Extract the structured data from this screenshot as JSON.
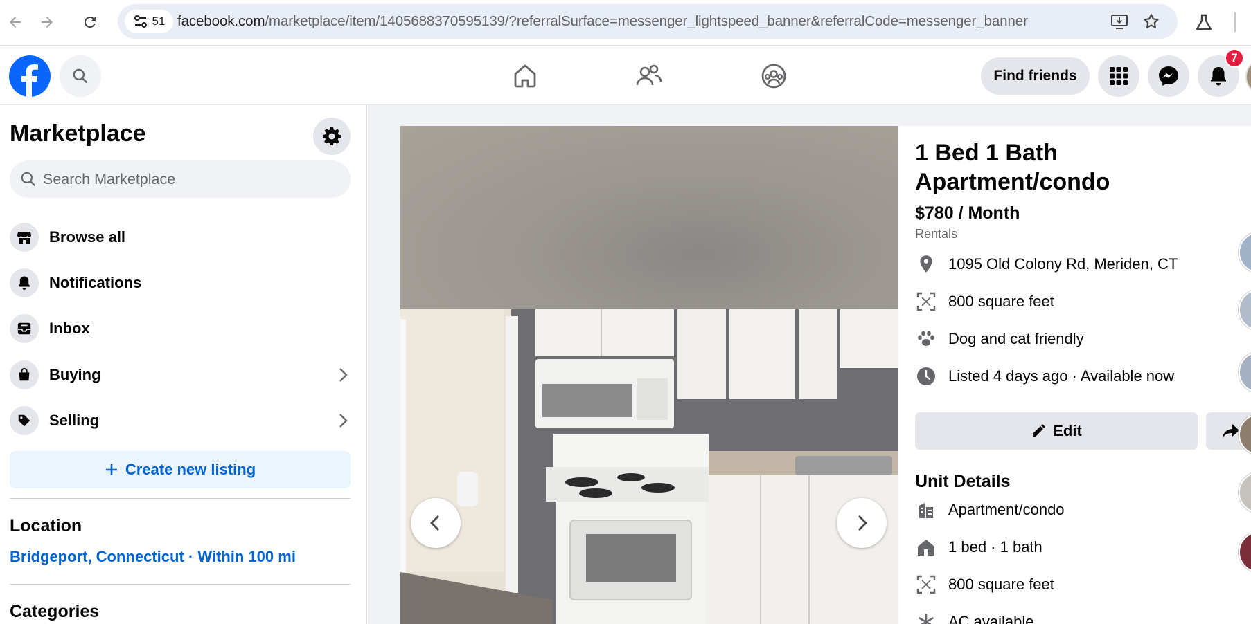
{
  "browser": {
    "tab_count": "51",
    "url_domain": "facebook.com",
    "url_rest": "/marketplace/item/1405688370595139/?referralSurface=messenger_lightspeed_banner&referralCode=messenger_banner"
  },
  "header": {
    "find_friends_label": "Find friends",
    "notification_count": "7"
  },
  "sidebar": {
    "title": "Marketplace",
    "search_placeholder": "Search Marketplace",
    "items": [
      {
        "label": "Browse all",
        "icon": "storefront-icon"
      },
      {
        "label": "Notifications",
        "icon": "bell-icon"
      },
      {
        "label": "Inbox",
        "icon": "inbox-icon"
      },
      {
        "label": "Buying",
        "icon": "shopping-bag-icon"
      },
      {
        "label": "Selling",
        "icon": "price-tag-icon"
      }
    ],
    "create_listing_label": "Create new listing",
    "location_heading": "Location",
    "location_value": "Bridgeport, Connecticut · Within 100 mi",
    "categories_heading": "Categories"
  },
  "listing": {
    "title": "1 Bed 1 Bath Apartment/condo",
    "price": "$780 / Month",
    "category": "Rentals",
    "facts": [
      {
        "icon": "location-pin-icon",
        "text": "1095 Old Colony Rd, Meriden, CT"
      },
      {
        "icon": "area-icon",
        "text": "800 square feet"
      },
      {
        "icon": "paw-icon",
        "text": "Dog and cat friendly"
      },
      {
        "icon": "clock-icon",
        "text": "Listed 4 days ago · Available now"
      }
    ],
    "edit_label": "Edit",
    "unit_details_heading": "Unit Details",
    "unit_details": [
      {
        "icon": "building-icon",
        "text": "Apartment/condo"
      },
      {
        "icon": "house-icon",
        "text": "1 bed · 1 bath"
      },
      {
        "icon": "area-icon",
        "text": "800 square feet"
      },
      {
        "icon": "snowflake-icon",
        "text": "AC available"
      }
    ]
  },
  "colors": {
    "fb_blue": "#0866ff",
    "link_blue": "#0064d1",
    "badge_red": "#e41e3f",
    "bg_gray": "#f0f2f5"
  }
}
